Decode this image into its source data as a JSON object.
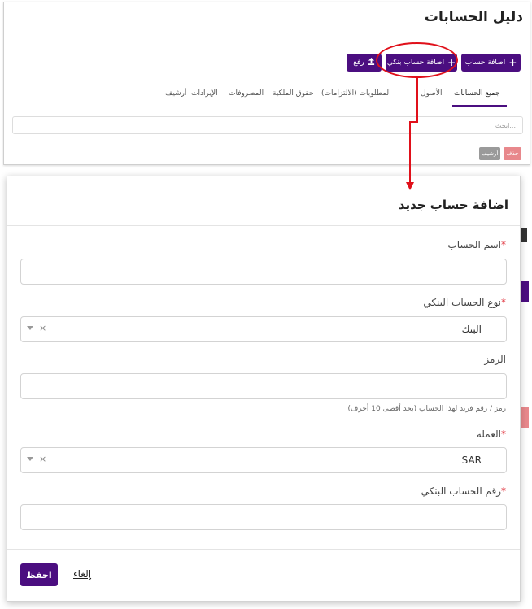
{
  "page": {
    "title": "دليل الحسابات",
    "buttons": {
      "add_account": "اضافة حساب",
      "add_bank_account": "اضافة حساب بنكي",
      "upload": "رفع"
    },
    "tabs": [
      {
        "label": "جميع الحسابات",
        "active": true
      },
      {
        "label": "الأصول",
        "active": false
      },
      {
        "label": "المطلوبات (الالتزامات)",
        "active": false
      },
      {
        "label": "حقوق الملكية",
        "active": false
      },
      {
        "label": "المصروفات",
        "active": false
      },
      {
        "label": "الإيرادات",
        "active": false
      },
      {
        "label": "أرشيف",
        "active": false
      }
    ],
    "search_placeholder": "ابحث...",
    "bulk": {
      "delete_label": "حذف",
      "archive_label": "أرشيف"
    }
  },
  "modal": {
    "title": "اضافة حساب جديد",
    "fields": {
      "account_name": {
        "label": "اسم الحساب",
        "required_mark": "*",
        "value": ""
      },
      "bank_account_type": {
        "label": "نوع الحساب البنكي",
        "required_mark": "*",
        "value": "البنك",
        "clear": "×"
      },
      "code": {
        "label": "الرمز",
        "value": "",
        "help": "رمز / رقم فريد لهذا الحساب (بحد أقصى 10 أحرف)"
      },
      "currency": {
        "label": "العملة",
        "required_mark": "*",
        "value": "SAR",
        "clear": "×"
      },
      "bank_account_number": {
        "label": "رقم الحساب البنكي",
        "required_mark": "*",
        "value": ""
      }
    },
    "actions": {
      "save_label": "احفظ",
      "cancel_label": "إلغاء"
    }
  },
  "colors": {
    "primary": "#4b0e80",
    "annotation": "#e0101a",
    "danger": "#e8888c"
  }
}
